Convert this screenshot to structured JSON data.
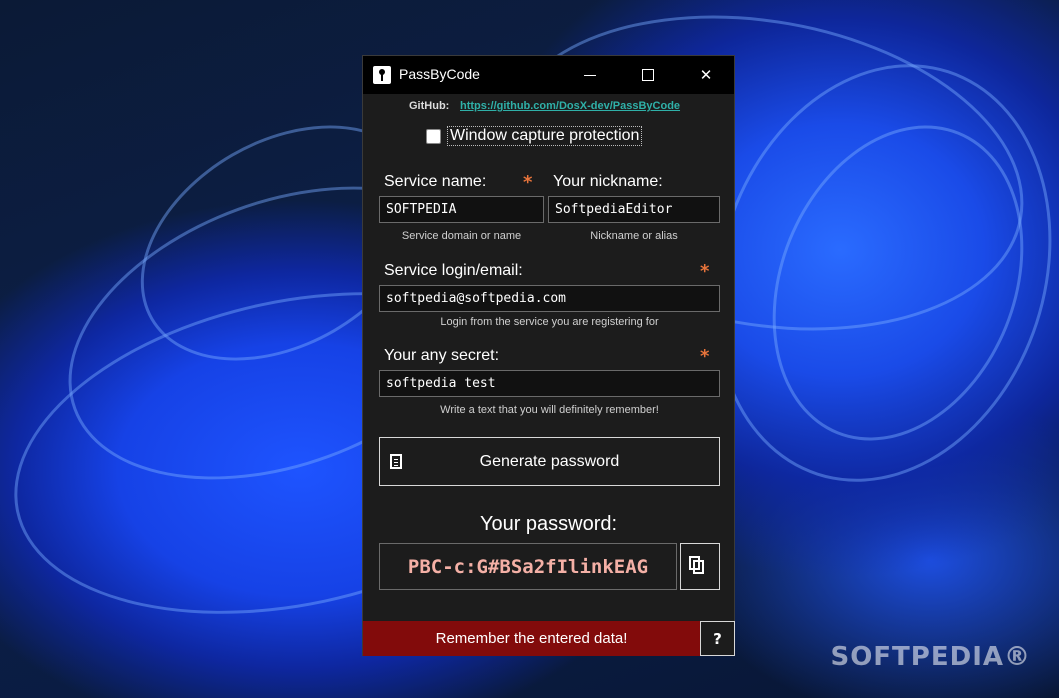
{
  "window": {
    "title": "PassByCode",
    "minimize_glyph": "",
    "close_glyph": "✕"
  },
  "github": {
    "label": "GitHub:",
    "url": "https://github.com/DosX-dev/PassByCode"
  },
  "capture": {
    "label": "Window capture protection",
    "checked": false
  },
  "form": {
    "service_name": {
      "label": "Service name:",
      "value": "SOFTPEDIA",
      "hint": "Service domain or name",
      "required": "*"
    },
    "nickname": {
      "label": "Your nickname:",
      "value": "SoftpediaEditor",
      "hint": "Nickname or alias"
    },
    "login": {
      "label": "Service login/email:",
      "value": "softpedia@softpedia.com",
      "hint": "Login from the service you are registering for",
      "required": "*"
    },
    "secret": {
      "label": "Your any secret:",
      "value": "softpedia test",
      "hint": "Write a text that you will definitely remember!",
      "required": "*"
    }
  },
  "generate_button": {
    "label": "Generate password",
    "icon": "notepad-icon"
  },
  "password": {
    "title": "Your password:",
    "value": "PBC-c:G#BSa2fIlinkEAG"
  },
  "copy_button": {
    "icon": "copy-icon"
  },
  "footer": {
    "label": "Remember the entered data!",
    "help": "?"
  },
  "desktop": {
    "watermark": "SOFTPEDIA®"
  },
  "colors": {
    "accent_red": "#820b0b",
    "required_orange": "#e8743b",
    "link_teal": "#2fb0a8",
    "password_pink": "#f4b0a6"
  }
}
